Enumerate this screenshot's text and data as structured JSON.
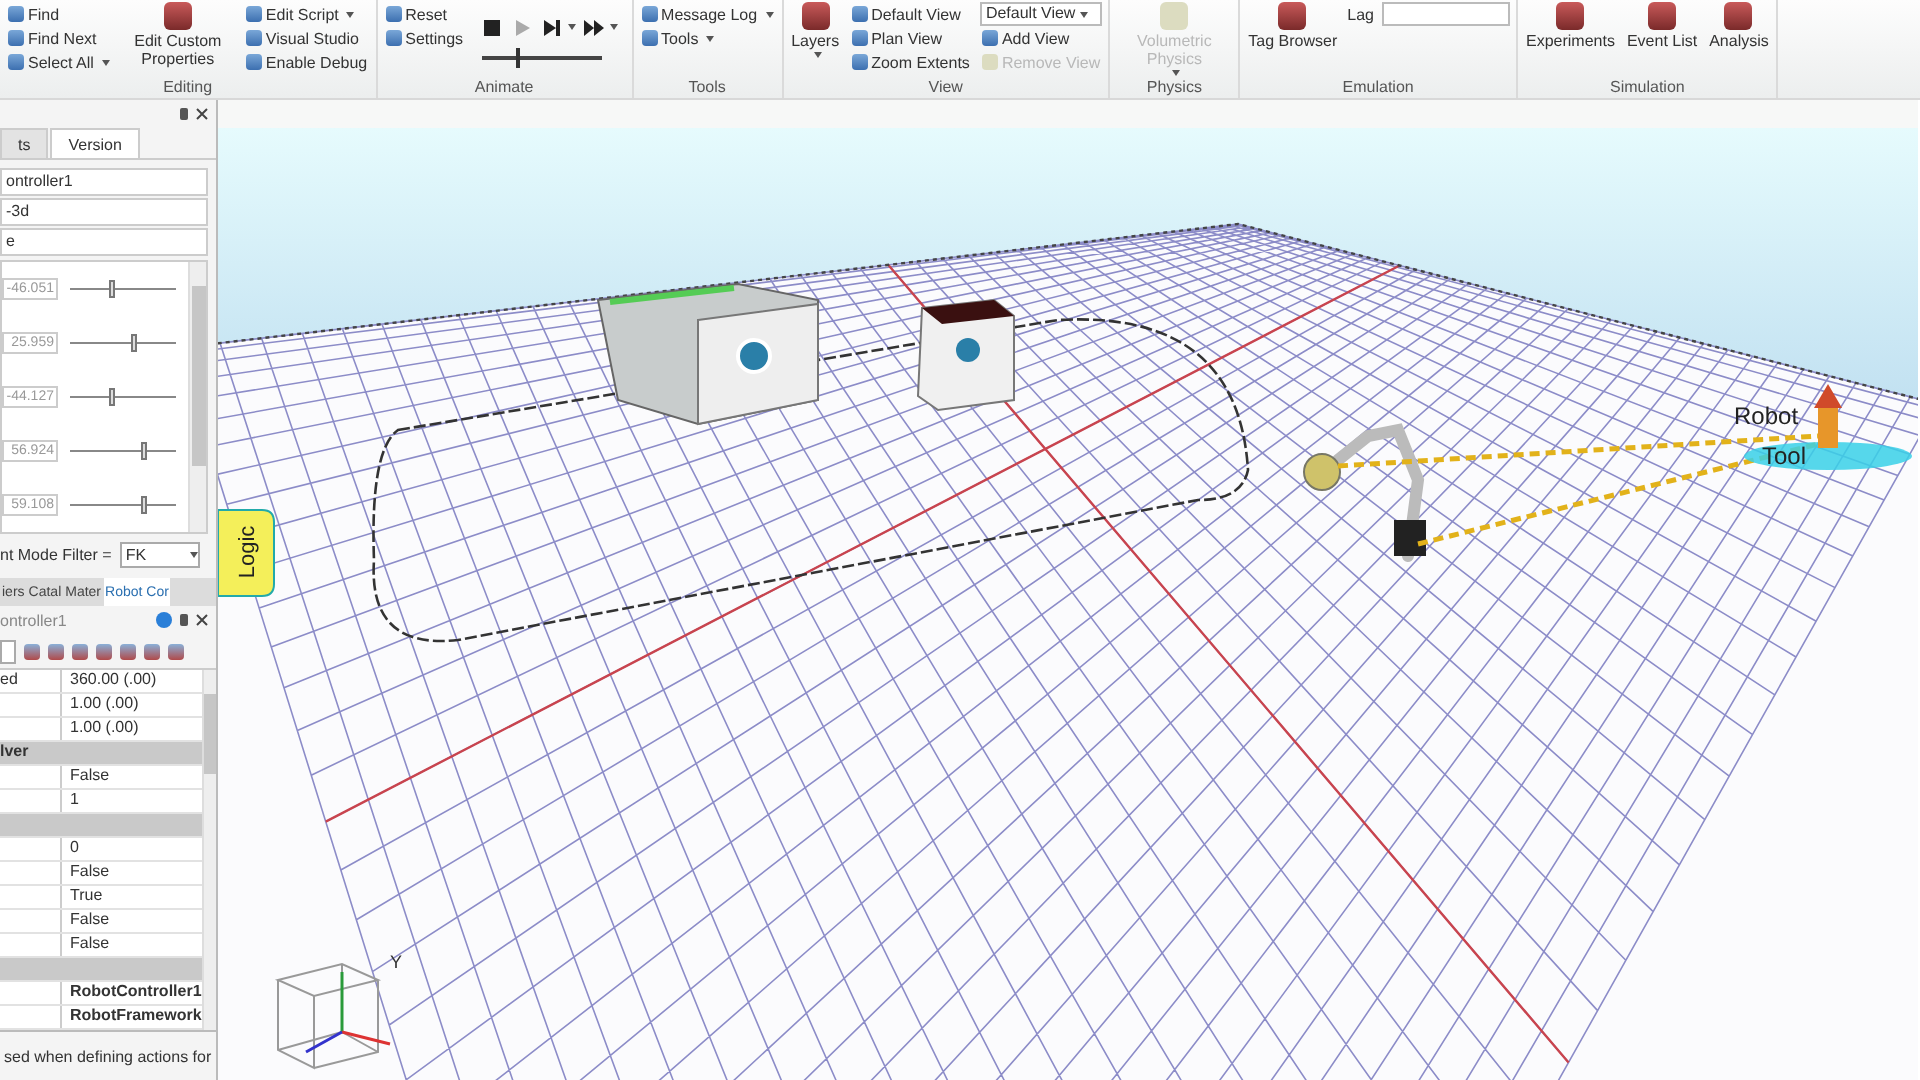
{
  "ribbon": {
    "groups": [
      {
        "label": "Editing",
        "items": [
          {
            "kind": "small",
            "label": "Find",
            "disabled": false
          },
          {
            "kind": "small",
            "label": "Find Next",
            "disabled": false
          },
          {
            "kind": "small",
            "label": "Select All",
            "dropdown": true,
            "disabled": false
          },
          {
            "kind": "large",
            "label": "Edit Custom Properties",
            "disabled": false
          },
          {
            "kind": "small",
            "label": "Edit Script",
            "dropdown": true,
            "disabled": false
          },
          {
            "kind": "small",
            "label": "Visual Studio",
            "disabled": false
          },
          {
            "kind": "small",
            "label": "Enable Debug",
            "disabled": false
          }
        ]
      },
      {
        "label": "Animate",
        "items": [
          {
            "kind": "small",
            "label": "Reset",
            "disabled": false
          },
          {
            "kind": "small",
            "label": "Settings",
            "disabled": false
          },
          {
            "kind": "playback",
            "level": 0.3,
            "buttons": [
              {
                "kind": "stop",
                "disabled": false
              },
              {
                "kind": "play",
                "disabled": true
              },
              {
                "kind": "step",
                "dropdown": true,
                "disabled": false
              },
              {
                "kind": "fast_forward",
                "dropdown": true,
                "disabled": false
              }
            ]
          }
        ]
      },
      {
        "label": "Tools",
        "items": [
          {
            "kind": "small",
            "label": "Message Log",
            "dropdown": true,
            "disabled": false
          },
          {
            "kind": "small",
            "label": "Tools",
            "dropdown": true,
            "disabled": false
          }
        ]
      },
      {
        "label": "View",
        "items": [
          {
            "kind": "large",
            "label": "Layers",
            "dropdown": true,
            "disabled": false
          },
          {
            "kind": "small",
            "label": "Default View",
            "disabled": false
          },
          {
            "kind": "small",
            "label": "Plan View",
            "disabled": false
          },
          {
            "kind": "small",
            "label": "Zoom Extents",
            "disabled": false
          },
          {
            "kind": "select",
            "value": "Default View",
            "disabled": false
          },
          {
            "kind": "small",
            "label": "Add View",
            "disabled": false
          },
          {
            "kind": "small",
            "label": "Remove View",
            "disabled": true
          }
        ]
      },
      {
        "label": "Physics",
        "items": [
          {
            "kind": "large",
            "label": "Volumetric Physics",
            "dropdown": true,
            "disabled": true
          }
        ]
      },
      {
        "label": "Emulation",
        "items": [
          {
            "kind": "large",
            "label": "Tag Browser",
            "disabled": false
          },
          {
            "kind": "field",
            "label": "Lag",
            "disabled": false
          }
        ]
      },
      {
        "label": "Simulation",
        "items": [
          {
            "kind": "large",
            "label": "Experiments",
            "disabled": false
          },
          {
            "kind": "large",
            "label": "Event List",
            "disabled": false
          },
          {
            "kind": "large",
            "label": "Analysis",
            "disabled": false
          }
        ]
      }
    ]
  },
  "left_panel": {
    "tabs": [
      {
        "label": "ts",
        "selected": false
      },
      {
        "label": "Version",
        "selected": true
      }
    ],
    "fields": [
      "ontroller1",
      "-3d",
      "e"
    ],
    "joints": [
      {
        "value": "-46.051",
        "level": 0.4
      },
      {
        "value": "25.959",
        "level": 0.6
      },
      {
        "value": "-44.127",
        "level": 0.4
      },
      {
        "value": "56.924",
        "level": 0.7
      },
      {
        "value": "59.108",
        "level": 0.7
      }
    ],
    "filter": {
      "label": "nt Mode Filter =",
      "value": "FK"
    },
    "bottom_tabs": [
      {
        "label": "iers",
        "selected": false
      },
      {
        "label": "Catal",
        "selected": false
      },
      {
        "label": "Mater",
        "selected": false
      },
      {
        "label": "Robot Cor",
        "selected": true
      }
    ],
    "properties": {
      "title": "ontroller1",
      "rows": [
        {
          "kind": "value",
          "name": "ed",
          "value": "360.00 (.00)",
          "bold": false
        },
        {
          "kind": "value",
          "value": "1.00 (.00)",
          "bold": false
        },
        {
          "kind": "value",
          "value": "1.00 (.00)",
          "bold": false
        },
        {
          "kind": "category",
          "name": "lver"
        },
        {
          "kind": "value",
          "value": "False",
          "bold": false
        },
        {
          "kind": "value",
          "value": "1",
          "bold": false
        },
        {
          "kind": "category"
        },
        {
          "kind": "value",
          "value": "0",
          "bold": false
        },
        {
          "kind": "value",
          "value": "False",
          "bold": false
        },
        {
          "kind": "value",
          "value": "True",
          "bold": false
        },
        {
          "kind": "value",
          "value": "False",
          "bold": false
        },
        {
          "kind": "value",
          "value": "False",
          "bold": false
        },
        {
          "kind": "category"
        },
        {
          "kind": "value",
          "value": "RobotController1",
          "bold": true
        },
        {
          "kind": "value",
          "value": "RobotFramework",
          "bold": true
        }
      ],
      "description": "sed when defining actions for"
    }
  },
  "viewport": {
    "logic_tag": "Logic",
    "labels": [
      "Robot",
      "Tool"
    ],
    "gizmo_axis": "Y"
  }
}
